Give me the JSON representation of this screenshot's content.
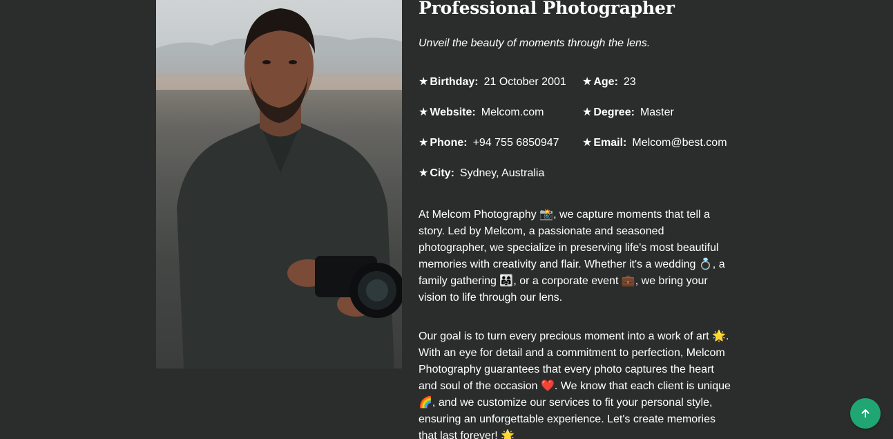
{
  "profile": {
    "title": "Professional Photographer",
    "tagline": "Unveil the beauty of moments through the lens."
  },
  "info": {
    "birthday": {
      "label": "Birthday:",
      "value": "21 October 2001"
    },
    "age": {
      "label": "Age:",
      "value": "23"
    },
    "website": {
      "label": "Website:",
      "value": "Melcom.com"
    },
    "degree": {
      "label": "Degree:",
      "value": "Master"
    },
    "phone": {
      "label": "Phone:",
      "value": "+94 755 6850947"
    },
    "email": {
      "label": "Email:",
      "value": "Melcom@best.com"
    },
    "city": {
      "label": "City:",
      "value": "Sydney, Australia"
    },
    "bullet": "★"
  },
  "paragraphs": {
    "p1": "At Melcom Photography 📸, we capture moments that tell a story. Led by Melcom, a passionate and seasoned photographer, we specialize in preserving life's most beautiful memories with creativity and flair. Whether it's a wedding 💍, a family gathering 👨‍👩‍👧, or a corporate event 💼, we bring your vision to life through our lens.",
    "p2": "Our goal is to turn every precious moment into a work of art 🌟. With an eye for detail and a commitment to perfection, Melcom Photography guarantees that every photo captures the heart and soul of the occasion ❤️. We know that each client is unique 🌈, and we customize our services to fit your personal style, ensuring an unforgettable experience. Let's create memories that last forever! 🌟"
  },
  "back_to_top": {
    "icon": "arrow-up-icon"
  },
  "colors": {
    "background": "#2b2d2d",
    "text": "#ffffff",
    "accent": "#1fa673"
  }
}
